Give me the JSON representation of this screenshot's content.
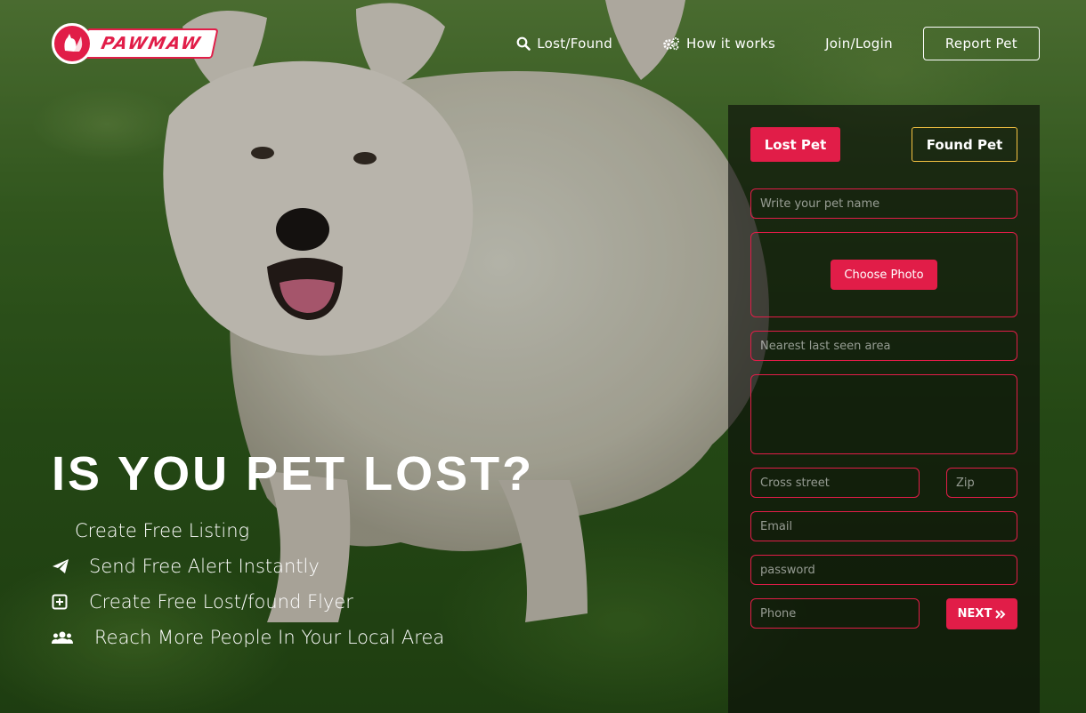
{
  "brand": {
    "name": "PAWMAW",
    "accent": "#e11d48"
  },
  "nav": {
    "items": [
      {
        "label": "Lost/Found",
        "icon": "search-icon"
      },
      {
        "label": "How it works",
        "icon": "gears-icon"
      },
      {
        "label": "Join/Login"
      }
    ],
    "report_button": "Report Pet"
  },
  "hero": {
    "title": "IS YOU PET LOST?",
    "features": [
      {
        "text": "Create Free Listing"
      },
      {
        "text": "Send Free Alert Instantly",
        "icon": "paper-plane-icon"
      },
      {
        "text": "Create Free Lost/found Flyer",
        "icon": "plus-square-icon"
      },
      {
        "text": "Reach More People In Your Local Area",
        "icon": "users-icon"
      }
    ]
  },
  "form": {
    "tabs": {
      "lost": "Lost Pet",
      "found": "Found Pet"
    },
    "pet_name_placeholder": "Write your pet name",
    "choose_photo": "Choose Photo",
    "area_placeholder": "Nearest last seen area",
    "description_placeholder": "",
    "cross_street_placeholder": "Cross street",
    "zip_placeholder": "Zip",
    "email_placeholder": "Email",
    "password_placeholder": "password",
    "phone_placeholder": "Phone",
    "next_label": "NEXT",
    "found_tab_border": "#f5c342"
  }
}
